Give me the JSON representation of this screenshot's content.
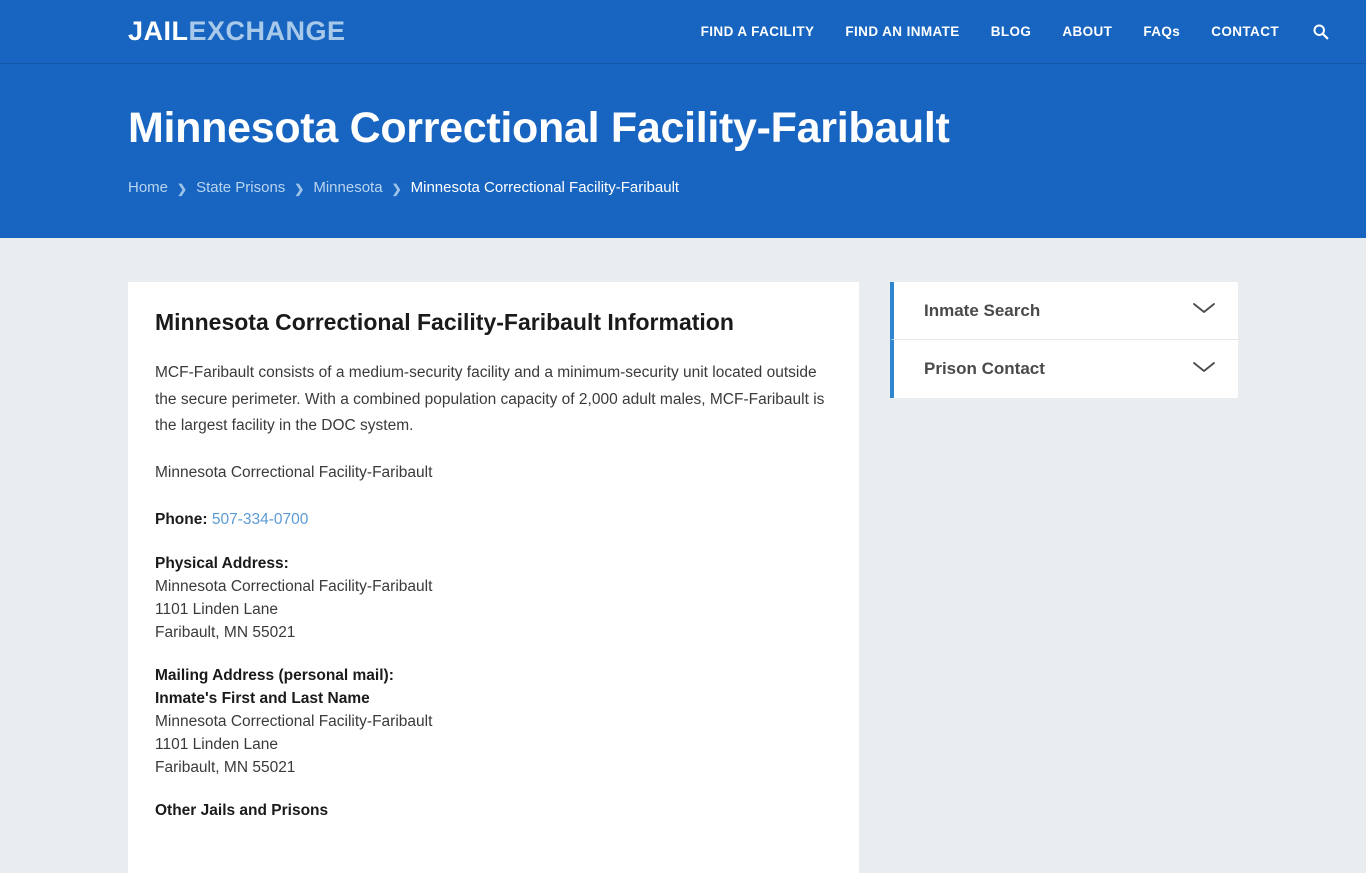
{
  "site": {
    "logo_primary": "JAIL",
    "logo_secondary": "EXCHANGE"
  },
  "nav": {
    "items": [
      {
        "label": "FIND A FACILITY"
      },
      {
        "label": "FIND AN INMATE"
      },
      {
        "label": "BLOG"
      },
      {
        "label": "ABOUT"
      },
      {
        "label": "FAQs"
      },
      {
        "label": "CONTACT"
      }
    ],
    "search_icon": "search-icon"
  },
  "hero": {
    "title": "Minnesota Correctional Facility-Faribault",
    "breadcrumb": [
      {
        "label": "Home",
        "current": false
      },
      {
        "label": "State Prisons",
        "current": false
      },
      {
        "label": "Minnesota",
        "current": false
      },
      {
        "label": "Minnesota Correctional Facility-Faribault",
        "current": true
      }
    ],
    "separator": "❯"
  },
  "main": {
    "heading": "Minnesota Correctional Facility-Faribault Information",
    "intro": "MCF-Faribault consists of a medium-security facility and a minimum-security unit located outside the secure perimeter. With a combined population capacity of 2,000 adult males, MCF-Faribault is the largest facility in the DOC system.",
    "facility_name": "Minnesota Correctional Facility-Faribault",
    "phone_label": "Phone:",
    "phone_number": "507-334-0700",
    "physical_address": {
      "label": "Physical Address:",
      "line1": "Minnesota Correctional Facility-Faribault",
      "line2": "1101 Linden Lane",
      "line3": "Faribault, MN 55021"
    },
    "mailing_address": {
      "label": "Mailing Address (personal mail):",
      "line0": "Inmate's First and Last Name",
      "line1": "Minnesota Correctional Facility-Faribault",
      "line2": "1101 Linden Lane",
      "line3": "Faribault, MN 55021"
    },
    "other_heading": "Other Jails and Prisons"
  },
  "sidebar": {
    "items": [
      {
        "label": "Inmate Search",
        "icon": "chevron-down-icon"
      },
      {
        "label": "Prison Contact",
        "icon": "chevron-down-icon"
      }
    ]
  },
  "colors": {
    "brand_blue": "#1765c0",
    "accent_blue": "#2e86d0",
    "link_blue": "#5b9bd5",
    "page_bg": "#eaedf0"
  }
}
